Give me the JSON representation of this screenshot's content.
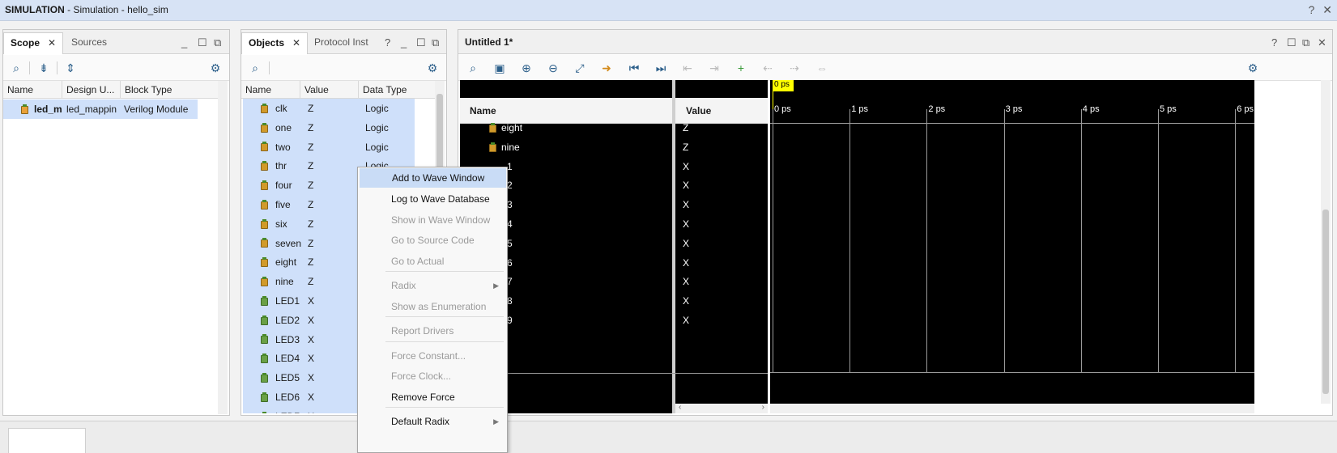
{
  "titlebar": {
    "mode": "SIMULATION",
    "rest": " - Simulation - hello_sim",
    "help": "?",
    "close": "✕"
  },
  "scope": {
    "tabs": [
      {
        "label": "Scope",
        "close": "✕"
      },
      {
        "label": "Sources"
      }
    ],
    "columns": [
      "Name",
      "Design U...",
      "Block Type"
    ],
    "rows": [
      {
        "name": "led_m",
        "design": "led_mappin",
        "block": "Verilog Module"
      }
    ]
  },
  "objects": {
    "tabs": [
      {
        "label": "Objects",
        "close": "✕"
      },
      {
        "label": "Protocol Inst"
      }
    ],
    "help": "?",
    "columns": [
      "Name",
      "Value",
      "Data Type"
    ],
    "rows": [
      {
        "name": "clk",
        "value": "Z",
        "type": "Logic"
      },
      {
        "name": "one",
        "value": "Z",
        "type": "Logic"
      },
      {
        "name": "two",
        "value": "Z",
        "type": "Logic"
      },
      {
        "name": "thr",
        "value": "Z",
        "type": "Logic"
      },
      {
        "name": "four",
        "value": "Z",
        "type": ""
      },
      {
        "name": "five",
        "value": "Z",
        "type": ""
      },
      {
        "name": "six",
        "value": "Z",
        "type": ""
      },
      {
        "name": "seven",
        "value": "Z",
        "type": ""
      },
      {
        "name": "eight",
        "value": "Z",
        "type": ""
      },
      {
        "name": "nine",
        "value": "Z",
        "type": ""
      },
      {
        "name": "LED1",
        "value": "X",
        "type": ""
      },
      {
        "name": "LED2",
        "value": "X",
        "type": ""
      },
      {
        "name": "LED3",
        "value": "X",
        "type": ""
      },
      {
        "name": "LED4",
        "value": "X",
        "type": ""
      },
      {
        "name": "LED5",
        "value": "X",
        "type": ""
      },
      {
        "name": "LED6",
        "value": "X",
        "type": ""
      },
      {
        "name": "LED7",
        "value": "X",
        "type": ""
      }
    ]
  },
  "context_menu": {
    "items": [
      {
        "label": "Add to Wave Window",
        "enabled": true,
        "highlighted": true
      },
      {
        "label": "Log to Wave Database",
        "enabled": true
      },
      {
        "label": "Show in Wave Window",
        "enabled": false
      },
      {
        "label": "Go to Source Code",
        "enabled": false
      },
      {
        "label": "Go to Actual",
        "enabled": false
      },
      {
        "label": "Radix",
        "enabled": false,
        "submenu": true
      },
      {
        "label": "Show as Enumeration",
        "enabled": false
      },
      {
        "label": "Report Drivers",
        "enabled": false
      },
      {
        "label": "Force Constant...",
        "enabled": false
      },
      {
        "label": "Force Clock...",
        "enabled": false
      },
      {
        "label": "Remove Force",
        "enabled": true
      },
      {
        "label": "Default Radix",
        "enabled": true,
        "submenu": true
      }
    ]
  },
  "wave": {
    "title": "Untitled 1*",
    "help": "?",
    "name_header": "Name",
    "value_header": "Value",
    "cursor_label": "0 ps",
    "time_labels": [
      "0 ps",
      "1 ps",
      "2 ps",
      "3 ps",
      "4 ps",
      "5 ps",
      "6 ps"
    ],
    "signals": [
      {
        "name": "eight",
        "value": "Z"
      },
      {
        "name": "nine",
        "value": "Z"
      },
      {
        "name": "1",
        "value": "X"
      },
      {
        "name": "2",
        "value": "X"
      },
      {
        "name": "3",
        "value": "X"
      },
      {
        "name": "4",
        "value": "X"
      },
      {
        "name": "5",
        "value": "X"
      },
      {
        "name": "6",
        "value": "X"
      },
      {
        "name": "7",
        "value": "X"
      },
      {
        "name": "8",
        "value": "X"
      },
      {
        "name": "9",
        "value": "X"
      }
    ]
  },
  "colors": {
    "cursor": "#ffff00",
    "selection": "#cfe0fa",
    "menu_highlight": "#c9dcf6"
  }
}
